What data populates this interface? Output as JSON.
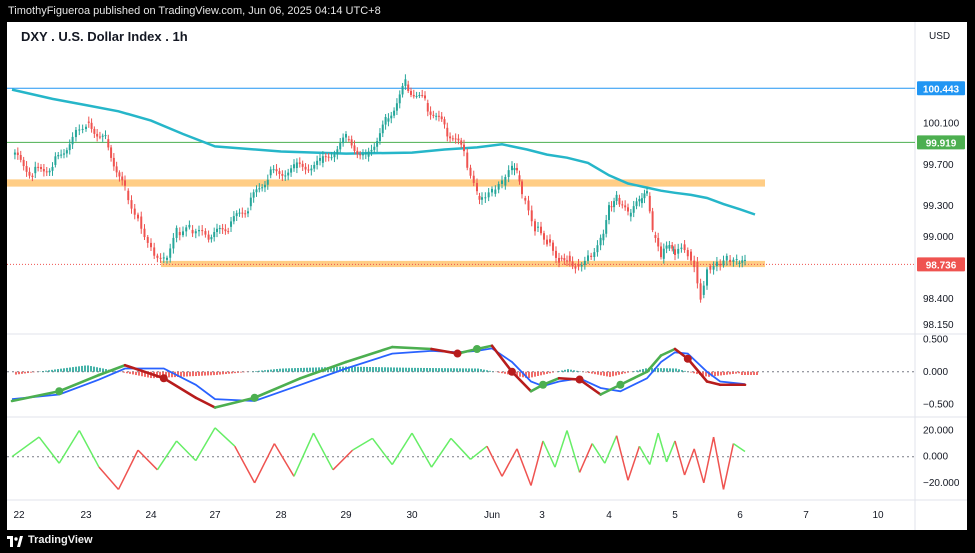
{
  "header": {
    "published_line": "TimothyFigueroa published on TradingView.com, Jun 06, 2025 04:14 UTC+8"
  },
  "chart_title": "DXY . U.S. Dollar Index . 1h",
  "currency_label": "USD",
  "footer": {
    "brand": "TradingView",
    "logo_icon": "tradingview-logo-icon"
  },
  "colors": {
    "up": "#26a69a",
    "down": "#ef5350",
    "ma": "#26b6c9",
    "zone": "#ffc878",
    "blue_line": "#2196f3",
    "green_line": "#4caf50",
    "macd_fast": "#4caf50",
    "macd_slow": "#2962ff",
    "macd_bear": "#b71c1c",
    "osc_up": "#66ee66",
    "osc_down": "#ef5350"
  },
  "chart_data": [
    {
      "type": "candlestick",
      "pane": "price",
      "x_tick_labels": [
        "22",
        "23",
        "24",
        "27",
        "28",
        "29",
        "30",
        "Jun",
        "3",
        "4",
        "5",
        "6",
        "7",
        "10"
      ],
      "y_tick_labels": [
        "100.100",
        "99.700",
        "99.300",
        "99.000",
        "98.400",
        "98.150"
      ],
      "ylim": [
        98.1,
        100.95
      ],
      "price_badges": [
        {
          "label": "100.443",
          "value": 100.443,
          "color": "#2196f3"
        },
        {
          "label": "99.919",
          "value": 99.919,
          "color": "#4caf50"
        },
        {
          "label": "98.736",
          "value": 98.736,
          "color": "#ef5350"
        }
      ],
      "horizontal_lines": [
        {
          "value": 100.443,
          "color": "#2196f3"
        },
        {
          "value": 99.919,
          "color": "#4caf50"
        }
      ],
      "zones": [
        {
          "from_day": "22",
          "to_day": "6",
          "low": 99.49,
          "high": 99.56
        },
        {
          "from_day": "24",
          "to_day": "6",
          "low": 98.71,
          "high": 98.77
        }
      ],
      "moving_average": {
        "x_days": [
          21.9,
          22.5,
          23.0,
          23.5,
          24.0,
          24.5,
          25.0,
          26.0,
          27.0,
          28.0,
          28.5,
          29.0,
          29.5,
          30.0,
          30.5,
          31.0,
          31.5,
          32.0,
          32.5,
          33.0,
          33.5,
          34.0,
          34.5,
          35.0,
          35.5,
          36.0,
          36.3
        ],
        "values": [
          100.43,
          100.34,
          100.28,
          100.22,
          100.13,
          100.0,
          99.88,
          99.83,
          99.81,
          99.82,
          99.85,
          99.87,
          99.9,
          99.85,
          99.8,
          99.77,
          99.72,
          99.6,
          99.52,
          99.48,
          99.45,
          99.43,
          99.41,
          99.38,
          99.32,
          99.27,
          99.22
        ]
      },
      "series": [
        {
          "name": "",
          "x_days": [
            21.9,
            22.2,
            22.5,
            22.8,
            23.0,
            23.3,
            23.6,
            23.8,
            24.0,
            24.2,
            24.4,
            24.6,
            24.9,
            25.2,
            25.5,
            25.8,
            26.2,
            26.6,
            27.0,
            27.3,
            27.6,
            27.9,
            28.2,
            28.5,
            28.8,
            29.0,
            29.1,
            29.3,
            29.5,
            29.7,
            29.8,
            29.9,
            30.2,
            30.5,
            30.8,
            31.0,
            31.2,
            31.5,
            31.8,
            32.0,
            32.2,
            32.5,
            32.8,
            33.0,
            33.2,
            33.5,
            33.7,
            33.9,
            34.0,
            34.2,
            34.4,
            34.6,
            34.8,
            35.0,
            35.3,
            35.6,
            35.9,
            36.1
          ],
          "values": [
            99.8,
            99.62,
            99.7,
            99.97,
            100.12,
            99.95,
            99.45,
            99.2,
            98.9,
            98.78,
            99.05,
            99.07,
            98.98,
            99.1,
            99.3,
            99.6,
            99.67,
            99.72,
            99.95,
            99.78,
            100.12,
            100.48,
            100.3,
            100.06,
            99.82,
            99.4,
            99.38,
            99.42,
            99.5,
            99.65,
            99.6,
            99.38,
            99.1,
            98.98,
            98.8,
            98.82,
            98.74,
            98.82,
            98.97,
            99.3,
            99.38,
            99.2,
            99.33,
            99.4,
            99.02,
            98.79,
            98.89,
            98.88,
            98.84,
            98.93,
            98.86,
            98.76,
            98.44,
            98.72,
            98.74,
            98.78,
            98.74,
            98.73
          ]
        }
      ]
    },
    {
      "type": "line",
      "pane": "macd",
      "y_tick_labels": [
        "0.500",
        "0.000",
        "−0.500"
      ],
      "ylim": [
        -0.65,
        0.55
      ],
      "series": [
        {
          "name": "",
          "x_days": [
            21.9,
            22.6,
            23.2,
            23.6,
            24.2,
            24.7,
            25.0,
            25.6,
            26.3,
            27.0,
            27.7,
            28.3,
            28.7,
            29.0,
            29.3,
            29.7,
            30.1,
            30.4,
            30.8,
            31.3,
            31.8,
            32.3,
            33.0,
            33.5,
            34.0,
            34.4,
            35.0,
            35.4,
            36.1
          ],
          "values": [
            -0.45,
            -0.3,
            -0.05,
            0.1,
            -0.1,
            -0.4,
            -0.55,
            -0.4,
            -0.1,
            0.15,
            0.38,
            0.35,
            0.28,
            0.35,
            0.4,
            0.0,
            -0.3,
            -0.2,
            -0.1,
            -0.12,
            -0.35,
            -0.2,
            0.0,
            0.25,
            0.35,
            0.2,
            -0.15,
            -0.2,
            -0.2
          ]
        },
        {
          "name": "",
          "x_days": [
            21.9,
            22.6,
            23.2,
            23.6,
            24.2,
            24.7,
            25.0,
            25.6,
            26.3,
            27.0,
            27.7,
            28.3,
            28.7,
            29.0,
            29.3,
            29.7,
            30.1,
            30.4,
            30.8,
            31.3,
            31.8,
            32.3,
            33.0,
            33.5,
            34.0,
            34.4,
            35.0,
            35.4,
            36.1
          ],
          "values": [
            -0.42,
            -0.35,
            -0.12,
            0.05,
            0.05,
            -0.2,
            -0.42,
            -0.45,
            -0.2,
            0.05,
            0.28,
            0.32,
            0.3,
            0.32,
            0.36,
            0.15,
            -0.15,
            -0.22,
            -0.15,
            -0.1,
            -0.25,
            -0.3,
            -0.1,
            0.15,
            0.3,
            0.28,
            0.0,
            -0.15,
            -0.19
          ]
        },
        {
          "name": "",
          "x_days": [
            21.9,
            23.0,
            24.0,
            25.0,
            26.0,
            27.0,
            28.0,
            29.0,
            30.0,
            31.0,
            32.0,
            33.0,
            34.0,
            35.0,
            36.0
          ],
          "values": [
            -0.05,
            0.1,
            -0.1,
            -0.05,
            0.05,
            0.08,
            0.06,
            0.05,
            -0.1,
            0.04,
            -0.08,
            0.06,
            0.05,
            -0.08,
            -0.02
          ]
        }
      ]
    },
    {
      "type": "line",
      "pane": "oscillator",
      "y_tick_labels": [
        "20.000",
        "0.000",
        "−20.000"
      ],
      "ylim": [
        -30,
        28
      ],
      "series": [
        {
          "name": "",
          "x_days": [
            21.9,
            22.3,
            22.6,
            22.9,
            23.2,
            23.5,
            23.8,
            24.1,
            24.4,
            24.7,
            25.0,
            25.3,
            25.6,
            25.9,
            26.2,
            26.5,
            26.8,
            27.1,
            27.4,
            27.7,
            28.0,
            28.3,
            28.6,
            28.9,
            29.2,
            29.5,
            29.8,
            30.1,
            30.4,
            30.7,
            31.0,
            31.3,
            31.6,
            31.9,
            32.2,
            32.5,
            32.8,
            33.1,
            33.4,
            33.7,
            34.0,
            34.3,
            34.6,
            34.9,
            35.2,
            35.5,
            35.8,
            36.1
          ],
          "values": [
            0,
            15,
            -5,
            20,
            -8,
            -25,
            5,
            -10,
            12,
            -3,
            22,
            8,
            -20,
            10,
            -15,
            18,
            -10,
            5,
            14,
            -6,
            18,
            -8,
            14,
            -2,
            8,
            -15,
            6,
            -22,
            12,
            -8,
            20,
            -12,
            10,
            -5,
            16,
            -18,
            8,
            -6,
            18,
            -4,
            12,
            -14,
            6,
            -20,
            15,
            -25,
            10,
            4
          ]
        }
      ]
    }
  ]
}
